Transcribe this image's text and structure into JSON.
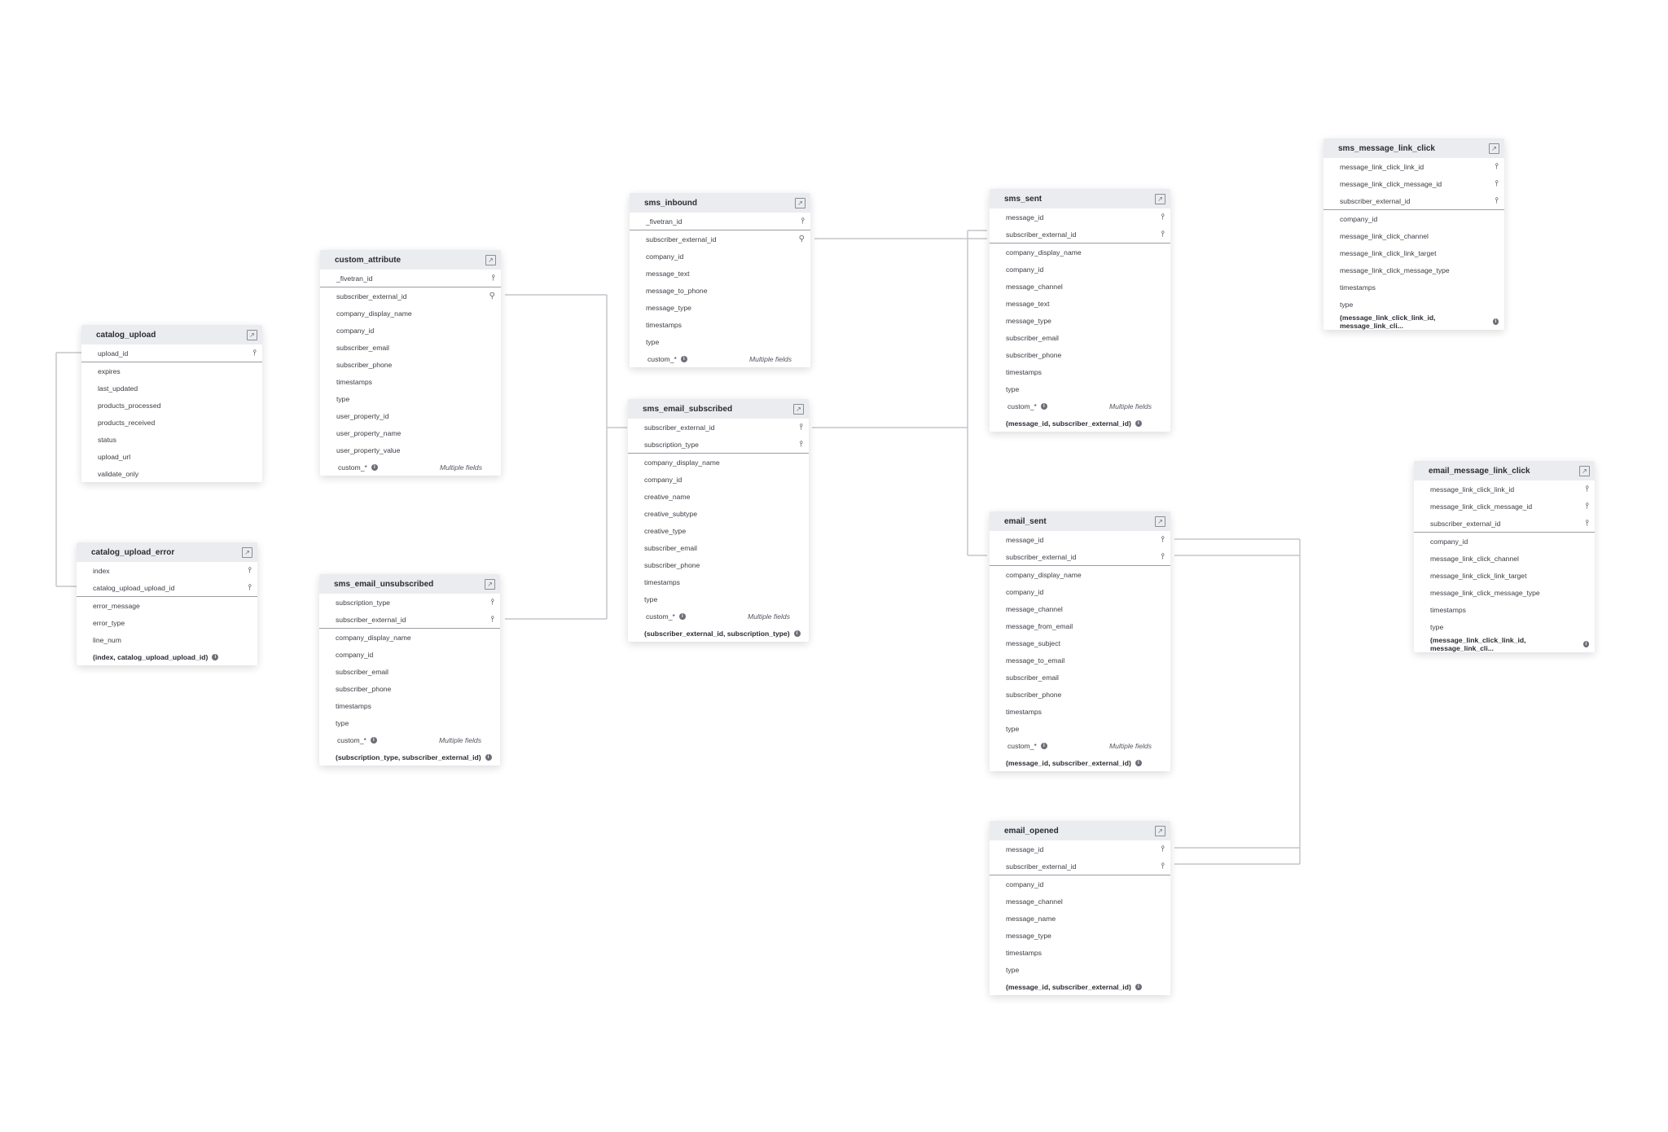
{
  "tables": {
    "catalog_upload": {
      "title": "catalog_upload",
      "pk": [
        "upload_id"
      ],
      "cols": [
        "expires",
        "last_updated",
        "products_processed",
        "products_received",
        "status",
        "upload_url",
        "validate_only"
      ]
    },
    "catalog_upload_error": {
      "title": "catalog_upload_error",
      "pk": [
        "index",
        "catalog_upload_upload_id"
      ],
      "cols": [
        "error_message",
        "error_type",
        "line_num"
      ],
      "composite": "(index, catalog_upload_upload_id)"
    },
    "custom_attribute": {
      "title": "custom_attribute",
      "pk": [
        "_fivetran_id"
      ],
      "cols": [
        "subscriber_external_id",
        "company_display_name",
        "company_id",
        "subscriber_email",
        "subscriber_phone",
        "timestamps",
        "type",
        "user_property_id",
        "user_property_name",
        "user_property_value"
      ],
      "custom": "custom_*",
      "custom_note": "Multiple fields"
    },
    "sms_email_unsubscribed": {
      "title": "sms_email_unsubscribed",
      "pk": [
        "subscription_type",
        "subscriber_external_id"
      ],
      "cols": [
        "company_display_name",
        "company_id",
        "subscriber_email",
        "subscriber_phone",
        "timestamps",
        "type"
      ],
      "custom": "custom_*",
      "custom_note": "Multiple fields",
      "composite": "(subscription_type, subscriber_external_id)"
    },
    "sms_inbound": {
      "title": "sms_inbound",
      "pk": [
        "_fivetran_id"
      ],
      "cols": [
        "subscriber_external_id",
        "company_id",
        "message_text",
        "message_to_phone",
        "message_type",
        "timestamps",
        "type"
      ],
      "custom": "custom_*",
      "custom_note": "Multiple fields"
    },
    "sms_email_subscribed": {
      "title": "sms_email_subscribed",
      "pk": [
        "subscriber_external_id",
        "subscription_type"
      ],
      "cols": [
        "company_display_name",
        "company_id",
        "creative_name",
        "creative_subtype",
        "creative_type",
        "subscriber_email",
        "subscriber_phone",
        "timestamps",
        "type"
      ],
      "custom": "custom_*",
      "custom_note": "Multiple fields",
      "composite": "(subscriber_external_id, subscription_type)"
    },
    "sms_sent": {
      "title": "sms_sent",
      "pk": [
        "message_id",
        "subscriber_external_id"
      ],
      "cols": [
        "company_display_name",
        "company_id",
        "message_channel",
        "message_text",
        "message_type",
        "subscriber_email",
        "subscriber_phone",
        "timestamps",
        "type"
      ],
      "custom": "custom_*",
      "custom_note": "Multiple fields",
      "composite": "(message_id, subscriber_external_id)"
    },
    "email_sent": {
      "title": "email_sent",
      "pk": [
        "message_id",
        "subscriber_external_id"
      ],
      "cols": [
        "company_display_name",
        "company_id",
        "message_channel",
        "message_from_email",
        "message_subject",
        "message_to_email",
        "subscriber_email",
        "subscriber_phone",
        "timestamps",
        "type"
      ],
      "custom": "custom_*",
      "custom_note": "Multiple fields",
      "composite": "(message_id, subscriber_external_id)"
    },
    "email_opened": {
      "title": "email_opened",
      "pk": [
        "message_id",
        "subscriber_external_id"
      ],
      "cols": [
        "company_id",
        "message_channel",
        "message_name",
        "message_type",
        "timestamps",
        "type"
      ],
      "composite": "(message_id, subscriber_external_id)"
    },
    "sms_message_link_click": {
      "title": "sms_message_link_click",
      "pk": [
        "message_link_click_link_id",
        "message_link_click_message_id",
        "subscriber_external_id"
      ],
      "cols": [
        "company_id",
        "message_link_click_channel",
        "message_link_click_link_target",
        "message_link_click_message_type",
        "timestamps",
        "type"
      ],
      "composite": "(message_link_click_link_id, message_link_cli..."
    },
    "email_message_link_click": {
      "title": "email_message_link_click",
      "pk": [
        "message_link_click_link_id",
        "message_link_click_message_id",
        "subscriber_external_id"
      ],
      "cols": [
        "company_id",
        "message_link_click_channel",
        "message_link_click_link_target",
        "message_link_click_message_type",
        "timestamps",
        "type"
      ],
      "composite": "(message_link_click_link_id, message_link_cli..."
    }
  },
  "foreign_keys": {
    "custom_attribute": [
      "subscriber_external_id"
    ],
    "sms_inbound": [
      "subscriber_external_id"
    ]
  },
  "icons": {
    "key": "key-icon",
    "fk": "foreign-key-icon",
    "open": "external-link-icon",
    "info": "info-icon"
  }
}
